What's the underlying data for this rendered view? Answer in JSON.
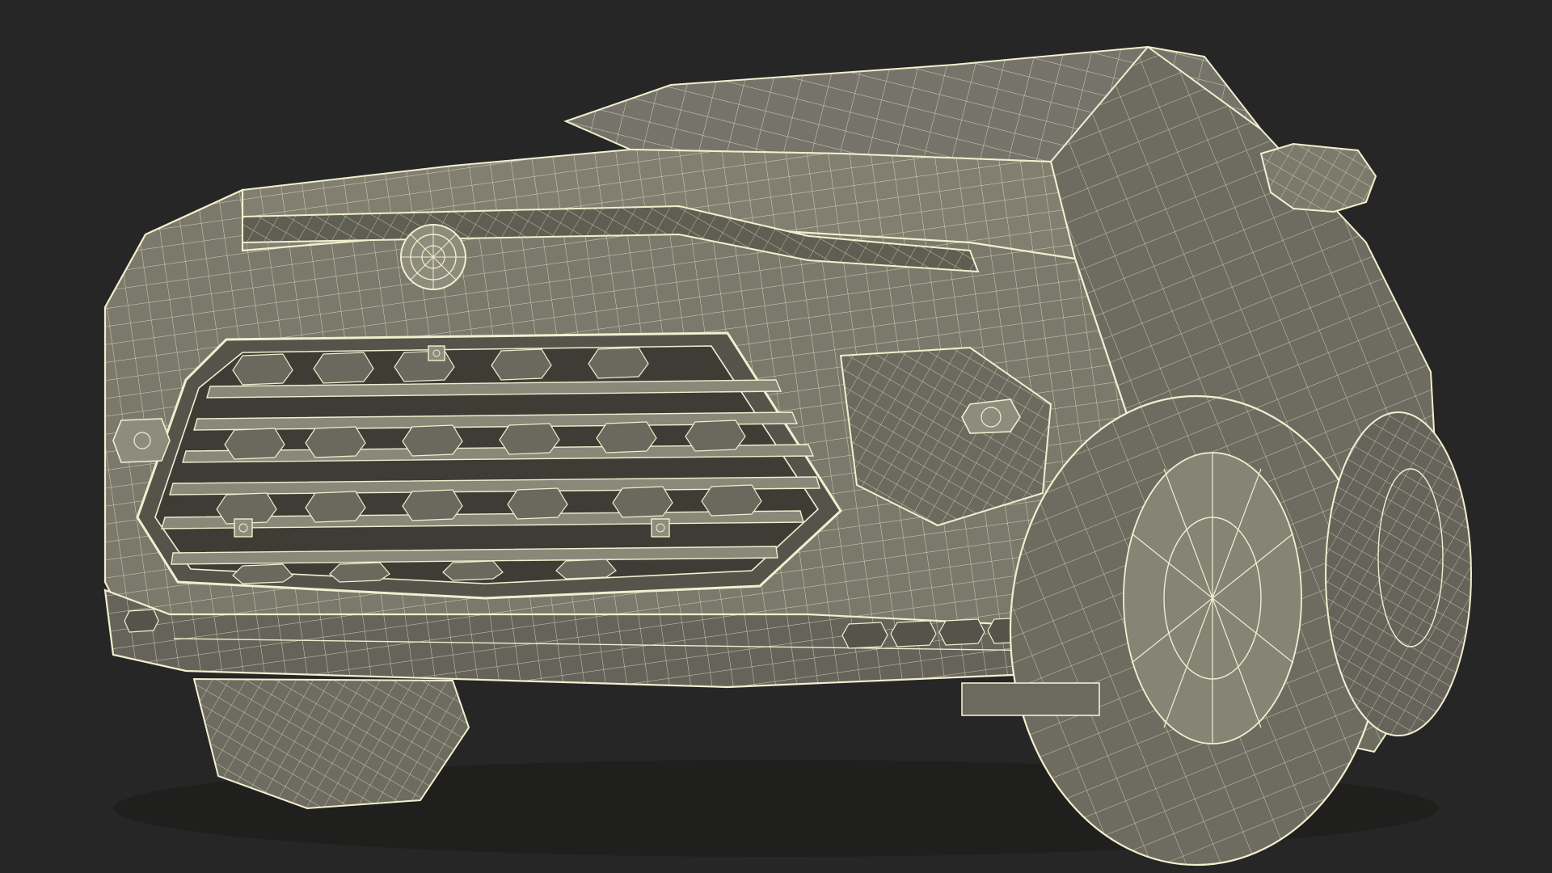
{
  "scene": {
    "subject": "suv-front-wireframe",
    "render_style": "wireframe-over-clay",
    "colors": {
      "background": "#262626",
      "body_fill": "#7c7a6c",
      "body_fill_dark": "#5c5b50",
      "body_fill_light": "#8e8c7d",
      "wire": "#f1efcf",
      "shadow": "#3a3a34"
    }
  }
}
